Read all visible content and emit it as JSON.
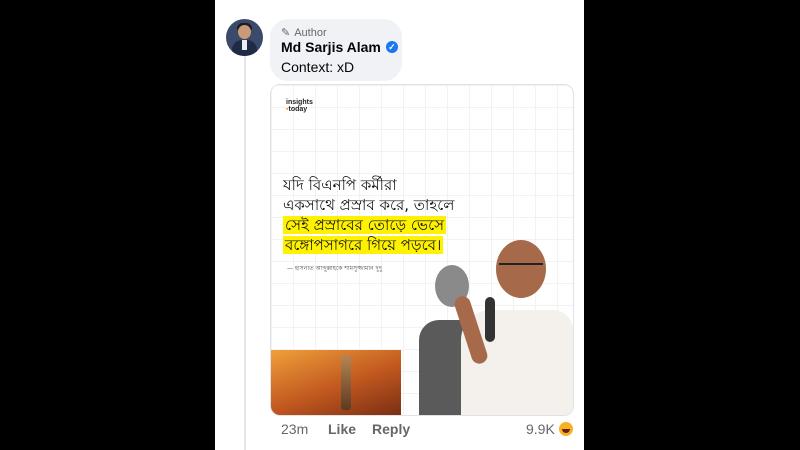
{
  "comment": {
    "author_badge": "Author",
    "author_name": "Md Sarjis Alam",
    "text": "Context: xD"
  },
  "post_card": {
    "logo_line1": "insights",
    "logo_line2": "today",
    "quote_lines": [
      "যদি বিএনপি কর্মীরা",
      "একসাথে প্রস্রাব করে, তাহলে",
      "সেই প্রস্রাবের তোড়ে ভেসে",
      "বঙ্গোপসাগরে গিয়ে পড়বে।"
    ],
    "byline": "— হাসনাত আব্দুল্লাহকে শামসুজ্জামান দুদু"
  },
  "footer": {
    "time": "23m",
    "like": "Like",
    "reply": "Reply",
    "reaction_count": "9.9K",
    "reaction_icon": "haha-emoji"
  },
  "colors": {
    "accent_blue": "#1877f2",
    "highlight_yellow": "#fff200",
    "logo_orange": "#f59a1b"
  }
}
